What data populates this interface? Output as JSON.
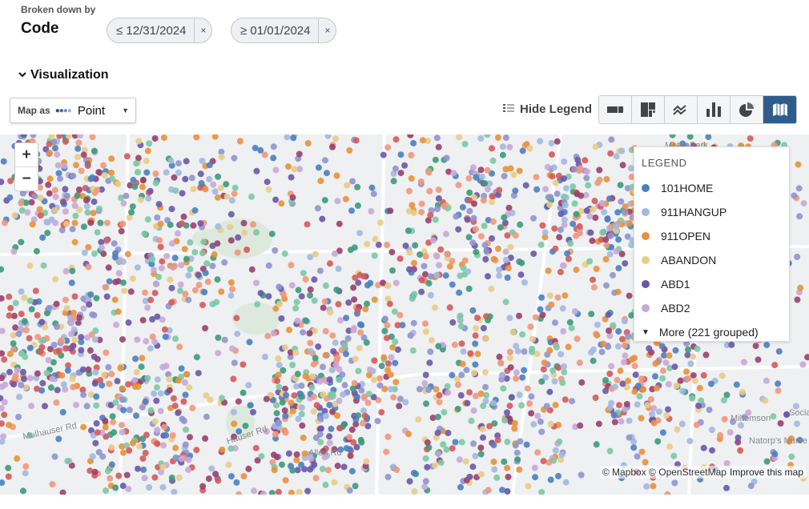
{
  "header": {
    "broken_down_by": "Broken down by",
    "field": "Code"
  },
  "filters": [
    {
      "label": "≤ 12/31/2024",
      "remove": "×"
    },
    {
      "label": "≥ 01/01/2024",
      "remove": "×"
    }
  ],
  "visualization": {
    "title": "Visualization",
    "map_as_label": "Map as",
    "map_as_value": "Point",
    "hide_legend": "Hide Legend",
    "types": [
      "table",
      "treemap",
      "line",
      "bar",
      "pie",
      "map"
    ],
    "selected_type": "map",
    "accent": "#2e5d8c"
  },
  "map": {
    "zoom_in": "+",
    "zoom_out": "−",
    "attribution": "© Mapbox © OpenStreetMap",
    "improve": "Improve this map",
    "labels": [
      "Mulhauser Rd",
      "Hauser Rd",
      "Allen Rd",
      "Miltomson",
      "Natorp's Nurse",
      "Social",
      "Metro Park"
    ]
  },
  "legend": {
    "title": "LEGEND",
    "items": [
      {
        "label": "101HOME",
        "color": "#4a7fc1"
      },
      {
        "label": "911HANGUP",
        "color": "#a2b8e0"
      },
      {
        "label": "911OPEN",
        "color": "#e8913a"
      },
      {
        "label": "ABANDON",
        "color": "#e8cc86"
      },
      {
        "label": "ABD1",
        "color": "#6a56a8"
      },
      {
        "label": "ABD2",
        "color": "#c9a7d8"
      }
    ],
    "more": "More (221 grouped)"
  }
}
